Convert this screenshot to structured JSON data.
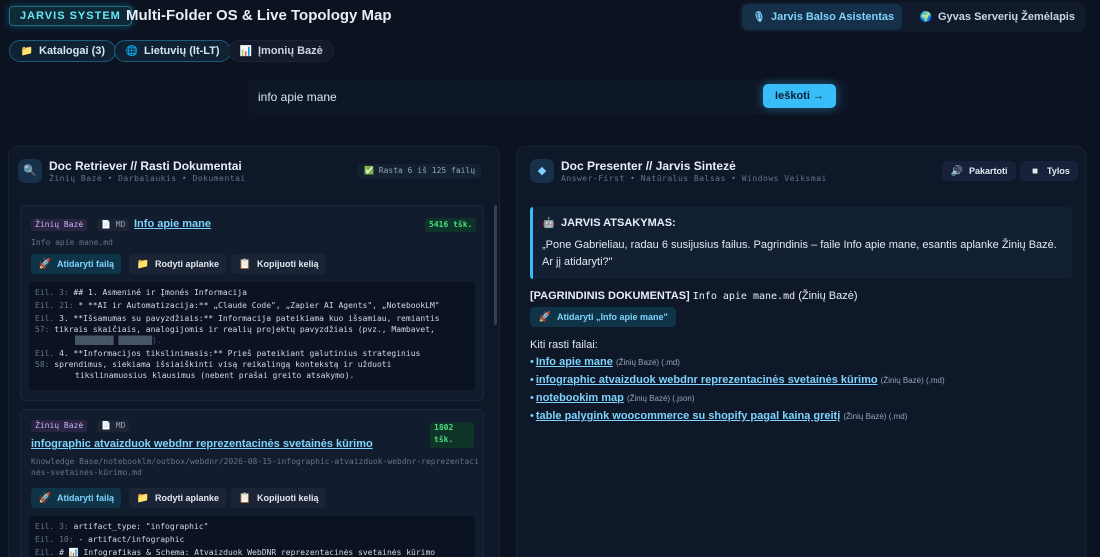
{
  "header": {
    "brand": "JARVIS SYSTEM",
    "title": "Multi-Folder OS & Live Topology Map",
    "tabs": [
      {
        "label": "Jarvis Balso Asistentas",
        "icon": "microphone-icon"
      },
      {
        "label": "Gyvas Serverių Žemėlapis",
        "icon": "globe-map-icon"
      }
    ]
  },
  "toolbar": {
    "folders": "Katalogai (3)",
    "language": "Lietuvių (lt-LT)",
    "company_base": "Įmonių Bazė"
  },
  "search": {
    "value": "info apie mane",
    "button": "Ieškoti →"
  },
  "left_panel": {
    "title": "Doc Retriever // Rasti Dokumentai",
    "subtitle": "Žinių Bazė • Darbalaukis • Dokumentai",
    "badge": "✅ Rasta 6 iš 125 failų",
    "actions": {
      "open": "Atidaryti failą",
      "show_folder": "Rodyti aplanke",
      "copy_path": "Kopijuoti kelią"
    },
    "cards": [
      {
        "tag": "Žinių Bazė",
        "type": "MD",
        "title": "Info apie mane",
        "score": "5416 tšk.",
        "path": "Info apie mane.md",
        "lines": [
          {
            "ln": "Eil. 3:",
            "text": "## 1. Asmeniné ir Įmonés Informacija"
          },
          {
            "ln": "Eil. 21:",
            "text": "* **AI ir Automatizacija:** „Claude Code\", „Zapier AI Agents\", „NotebookLM\""
          },
          {
            "ln": "Eil.",
            "text": "3. **Išsamumas su pavyzdžiais:** Informacija pateikiama kuo išsamiau, remiantis"
          },
          {
            "ln": "57:",
            "text": "tikrais skaičiais, analogijomis ir realių projektų pavyzdžiais (pvz., Mambavet,"
          },
          {
            "ln": "",
            "text": "████████ ███████)."
          },
          {
            "ln": "Eil.",
            "text": "4. **Informacijos tikslinimasis:** Prieš pateikiant galutinius strateginius"
          },
          {
            "ln": "58:",
            "text": "sprendimus, siekiama išsiaiškinti visą reikalingą kontekstą ir užduoti"
          },
          {
            "ln": "",
            "text": "tikslinamuosius klausimus (nebent prašai greito atsakymo)."
          }
        ]
      },
      {
        "tag": "Žinių Bazė",
        "type": "MD",
        "title": "infographic atvaizduok webdnr reprezentacinės svetainės kūrimo",
        "score": "1802 tšk.",
        "path": "Knowledge Base/notebooklm/outbox/webdnr/2026-08-15-infographic-atvaizduok-webdnr-reprezentacinės-svetainės-kūrimo.md",
        "lines": [
          {
            "ln": "Eil. 3:",
            "text": "artifact_type: \"infographic\""
          },
          {
            "ln": "Eil. 10:",
            "text": "- artifact/infographic"
          },
          {
            "ln": "Eil.",
            "text": "# 📊 Infografikas & Schema: Atvaizduok WebDNR reprezentacinės svetainės kūrimo"
          }
        ]
      }
    ]
  },
  "right_panel": {
    "title": "Doc Presenter // Jarvis Sintezė",
    "subtitle": "Answer-First • Natūralus Balsas • Windows Veiksmai",
    "repeat": "Pakartoti",
    "silence": "Tylos",
    "answer_label": "JARVIS ATSAKYMAS:",
    "answer_text": "„Pone Gabrieliau, radau 6 susijusius failus. Pagrindinis – faile Info apie mane, esantis aplanke Žinių Bazė. Ar jį atidaryti?\"",
    "main_doc_label": "[PAGRINDINIS DOKUMENTAS]",
    "main_doc_file": "Info apie mane.md",
    "main_doc_folder": "(Žinių Bazė)",
    "main_open": "Atidaryti „Info apie mane\"",
    "others_label": "Kiti rasti failai:",
    "others": [
      {
        "name": "Info apie mane",
        "meta": "(Žinių Bazė) (.md)"
      },
      {
        "name": "infographic atvaizduok webdnr reprezentacinės svetainės kūrimo",
        "meta": "(Žinių Bazė) (.md)"
      },
      {
        "name": "notebookim map",
        "meta": "(Žinių Bazė) (.json)"
      },
      {
        "name": "table palygink woocommerce su shopify pagal kainą greitį",
        "meta": "(Žinių Bazė) (.md)"
      }
    ]
  },
  "colors": {
    "accent": "#38bdf8",
    "background": "#0b1220",
    "panel": "#0f1828",
    "score": "#4ade80"
  }
}
